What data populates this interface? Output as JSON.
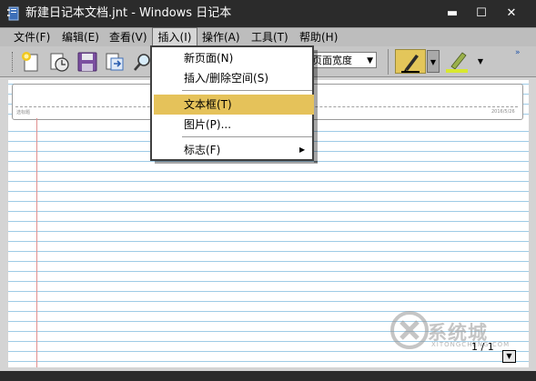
{
  "window": {
    "title": "新建日记本文档.jnt - Windows 日记本",
    "min_glyph": "▬",
    "max_glyph": "☐",
    "close_glyph": "✕"
  },
  "menubar": {
    "items": [
      {
        "label": "文件(F)"
      },
      {
        "label": "编辑(E)"
      },
      {
        "label": "查看(V)"
      },
      {
        "label": "插入(I)",
        "open": true
      },
      {
        "label": "操作(A)"
      },
      {
        "label": "工具(T)"
      },
      {
        "label": "帮助(H)"
      }
    ]
  },
  "toolbar": {
    "icons": [
      "new-page-icon",
      "timestamp-icon",
      "save-icon",
      "export-icon",
      "find-icon"
    ],
    "zoom_value": "页面宽度",
    "zoom_arrow": "▼",
    "pen_dropdown_arrow": "▼",
    "highlighter_dropdown_arrow": "▼",
    "more_glyph": "»",
    "pen_color": "#e3c65a",
    "highlighter_color": "#d8e830"
  },
  "insert_menu": {
    "items": [
      {
        "label": "新页面(N)"
      },
      {
        "label": "插入/删除空间(S)"
      },
      {
        "label": "文本框(T)",
        "highlighted": true
      },
      {
        "label": "图片(P)..."
      },
      {
        "label": "标志(F)",
        "submenu": true
      }
    ],
    "submenu_arrow": "▶",
    "highlight_color": "#e5c25a"
  },
  "note": {
    "header_left": "选标题",
    "header_date": "2016/5/26",
    "rule_color": "#9ecbe6",
    "margin_color": "#e09090"
  },
  "pager": {
    "counter": "1 / 1",
    "nav_glyph": "▼"
  },
  "watermark": {
    "text": "系统城",
    "url": "XITONGCHENG.COM"
  }
}
